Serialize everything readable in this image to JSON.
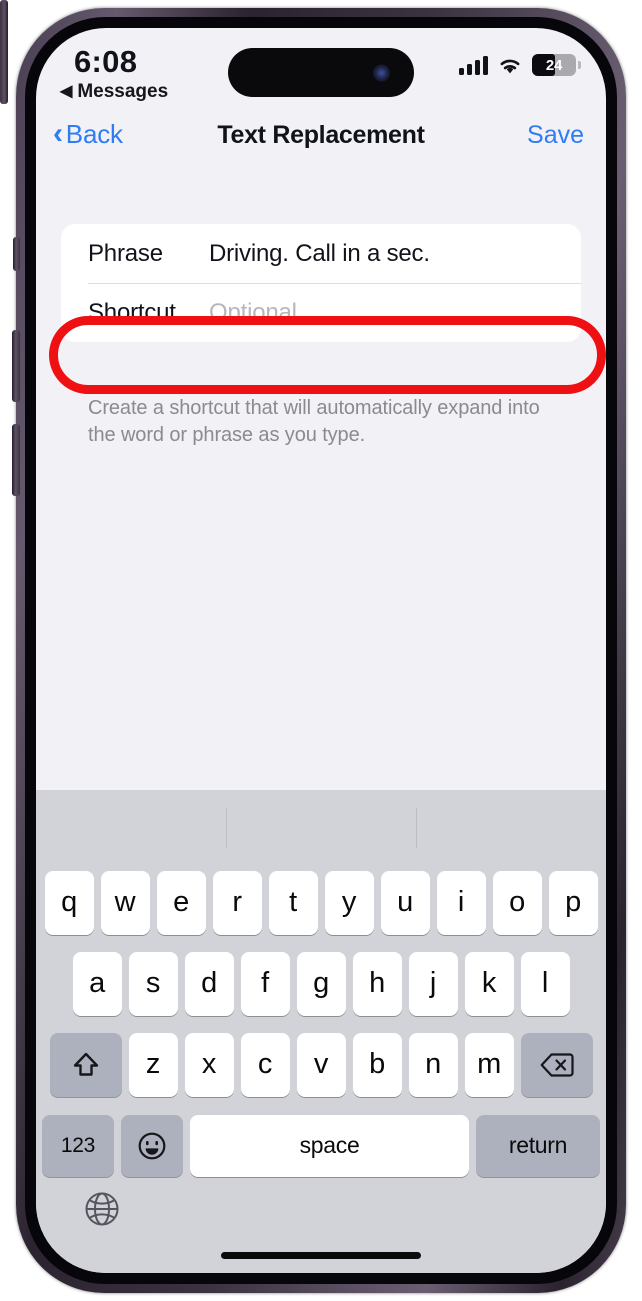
{
  "status_bar": {
    "time": "6:08",
    "back_to_app_label": "Messages",
    "back_to_app_arrow": "◀",
    "cellular_icon": "cellular-signal-icon",
    "wifi_icon": "wifi-icon",
    "battery_percent": "24",
    "battery_level_fraction": 0.24
  },
  "nav_bar": {
    "back_label": "Back",
    "back_chevron": "‹",
    "title": "Text Replacement",
    "save_label": "Save",
    "accent_color": "#2e7cf6"
  },
  "form": {
    "rows": [
      {
        "label": "Phrase",
        "value": "Driving. Call in a sec.",
        "is_placeholder": false
      },
      {
        "label": "Shortcut",
        "value": "Optional",
        "is_placeholder": true
      }
    ],
    "footer_note": "Create a shortcut that will automatically expand into the word or phrase as you type."
  },
  "highlight": {
    "target": "shortcut-row",
    "color": "#ee1013",
    "shape": "rounded-oval-outline"
  },
  "keyboard": {
    "predictive_bar_empty": true,
    "row1": [
      "q",
      "w",
      "e",
      "r",
      "t",
      "y",
      "u",
      "i",
      "o",
      "p"
    ],
    "row2": [
      "a",
      "s",
      "d",
      "f",
      "g",
      "h",
      "j",
      "k",
      "l"
    ],
    "row3_letters": [
      "z",
      "x",
      "c",
      "v",
      "b",
      "n",
      "m"
    ],
    "shift_icon": "shift-arrow-icon",
    "backspace_icon": "backspace-delete-icon",
    "numeric_label": "123",
    "emoji_icon": "emoji-smiley-icon",
    "space_label": "space",
    "return_label": "return",
    "globe_icon": "globe-language-icon"
  },
  "colors": {
    "screen_background": "#f2f1f6",
    "card_background": "#ffffff",
    "keyboard_background": "#d1d3d9",
    "key_light": "#ffffff",
    "key_dark": "#adb1bd",
    "text_primary": "#11131a",
    "text_placeholder": "#b6b6bb",
    "text_secondary": "#8a8a8f"
  }
}
